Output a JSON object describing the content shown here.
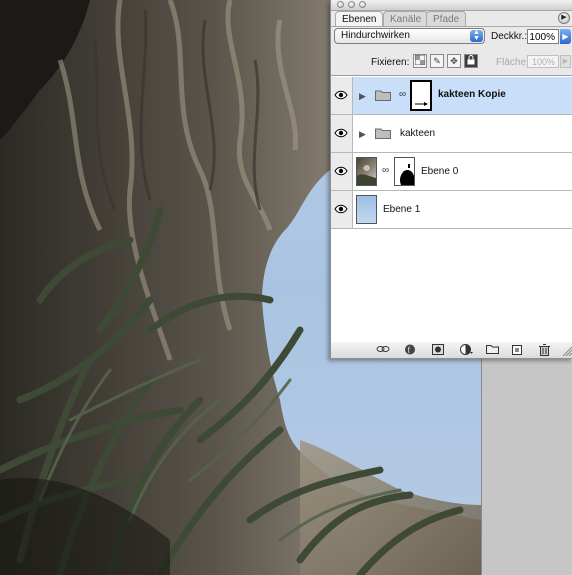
{
  "palette": {
    "tabs": [
      {
        "label": "Ebenen",
        "active": true
      },
      {
        "label": "Kanäle",
        "active": false
      },
      {
        "label": "Pfade",
        "active": false
      }
    ],
    "menu_icon": "triangle-right-icon",
    "blend_mode": "Hindurchwirken",
    "opacity_label": "Deckkr.:",
    "opacity_value": "100%",
    "lock_label": "Fixieren:",
    "fill_label": "Fläche:",
    "fill_value": "100%",
    "layers": [
      {
        "name": "kakteen Kopie",
        "type": "group",
        "selected": true,
        "has_mask": true,
        "visible": true
      },
      {
        "name": "kakteen",
        "type": "group",
        "selected": false,
        "has_mask": false,
        "visible": true
      },
      {
        "name": "Ebene 0",
        "type": "layer",
        "selected": false,
        "has_mask": true,
        "visible": true
      },
      {
        "name": "Ebene 1",
        "type": "layer",
        "selected": false,
        "has_mask": false,
        "visible": true
      }
    ],
    "bottom_icons": [
      "link-icon",
      "layer-style-icon",
      "mask-icon",
      "adjustment-layer-icon",
      "new-group-icon",
      "new-layer-icon",
      "trash-icon"
    ]
  },
  "colors": {
    "selection": "#c9def8",
    "sky": "#aec8e4",
    "panel": "#e9e9e9"
  }
}
